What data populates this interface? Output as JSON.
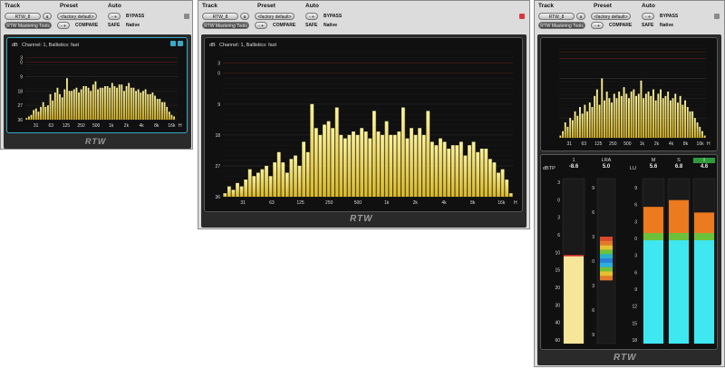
{
  "header": {
    "track_label": "Track",
    "preset_label": "Preset",
    "auto_label": "Auto",
    "track_name": "RTW_8",
    "track_suffix": "a",
    "preset_value": "<factory default>",
    "minus_plus": "- +",
    "bypass": "BYPASS",
    "compare": "COMPARE",
    "safe": "SAFE",
    "native": "Native",
    "plugin_name": "RTW Mastering Tools"
  },
  "chart_title": "Channel: 1, Ballistics: fast",
  "y_unit": "dB",
  "x_unit": "H",
  "logo": "RTW",
  "colors": {
    "bar": "#f2e27a",
    "window": "#dcdcdc",
    "bg": "#101010",
    "accent": "#35a9c7"
  },
  "chart_data": [
    {
      "type": "bar",
      "title": "Channel: 1, Ballistics: fast",
      "ylabel": "dB",
      "yticks": [
        "3",
        "0",
        "9",
        "18",
        "27",
        "36"
      ],
      "xticks": [
        "31",
        "63",
        "125",
        "250",
        "500",
        "1k",
        "2k",
        "4k",
        "8k",
        "16k"
      ],
      "ylim": [
        -36,
        6
      ],
      "values": [
        -35,
        -34,
        -33,
        -30,
        -29,
        -31,
        -28,
        -25,
        -28,
        -27,
        -20,
        -24,
        -19,
        -16,
        -20,
        -22,
        -17,
        -10,
        -18,
        -18,
        -17,
        -16,
        -19,
        -17,
        -15,
        -15,
        -16,
        -18,
        -14,
        -12,
        -17,
        -16,
        -16,
        -15,
        -15,
        -16,
        -13,
        -15,
        -16,
        -14,
        -14,
        -18,
        -15,
        -13,
        -16,
        -16,
        -18,
        -17,
        -19,
        -18,
        -17,
        -20,
        -20,
        -19,
        -21,
        -23,
        -23,
        -25,
        -25,
        -28,
        -31,
        -33,
        -34,
        -36
      ]
    },
    {
      "type": "bar",
      "title": "Channel: 1, Ballistics: fast",
      "ylabel": "dB",
      "yticks": [
        "3",
        "0",
        "9",
        "18",
        "27",
        "36"
      ],
      "xticks": [
        "31",
        "63",
        "125",
        "250",
        "500",
        "1k",
        "2k",
        "4k",
        "8k",
        "16k"
      ],
      "ylim": [
        -36,
        6
      ],
      "values": [
        -35,
        -33,
        -34,
        -32,
        -33,
        -31,
        -28,
        -30,
        -29,
        -28,
        -27,
        -30,
        -26,
        -23,
        -26,
        -29,
        -25,
        -24,
        -27,
        -20,
        -23,
        -9,
        -16,
        -18,
        -15,
        -14,
        -16,
        -10,
        -18,
        -19,
        -18,
        -17,
        -18,
        -16,
        -17,
        -19,
        -11,
        -17,
        -18,
        -14,
        -18,
        -18,
        -17,
        -10,
        -19,
        -16,
        -18,
        -16,
        -18,
        -11,
        -20,
        -21,
        -19,
        -20,
        -22,
        -21,
        -21,
        -20,
        -24,
        -21,
        -20,
        -23,
        -22,
        -22,
        -25,
        -26,
        -29,
        -28,
        -31,
        -35
      ]
    },
    {
      "type": "bar",
      "title": "",
      "xticks": [
        "31",
        "63",
        "125",
        "250",
        "500",
        "1k",
        "2k",
        "4k",
        "8k",
        "16k"
      ],
      "ylim": [
        -36,
        6
      ],
      "values": [
        -35,
        -33,
        -29,
        -31,
        -27,
        -28,
        -24,
        -26,
        -22,
        -25,
        -21,
        -24,
        -20,
        -22,
        -17,
        -14,
        -21,
        -9,
        -19,
        -15,
        -18,
        -20,
        -16,
        -18,
        -15,
        -17,
        -13,
        -16,
        -18,
        -15,
        -14,
        -17,
        -16,
        -10,
        -18,
        -16,
        -15,
        -17,
        -14,
        -19,
        -16,
        -14,
        -18,
        -17,
        -15,
        -19,
        -18,
        -16,
        -20,
        -17,
        -21,
        -19,
        -22,
        -24,
        -24,
        -27,
        -29,
        -31,
        -33,
        -35
      ]
    }
  ],
  "meters": {
    "peak": {
      "label": "1",
      "value": "-8.6",
      "unit": "dBTP",
      "level": -8.6,
      "scale": [
        "3",
        "0",
        "3",
        "6",
        "10",
        "15",
        "20",
        "30",
        "40",
        "60"
      ]
    },
    "lra": {
      "label": "LRA",
      "value": "5.0",
      "scale": [
        "9",
        "6",
        "3",
        "0",
        "3",
        "6",
        "9"
      ]
    },
    "loud_unit": "LU",
    "loudness": [
      {
        "label": "M",
        "value": "5.6",
        "level": 5.6
      },
      {
        "label": "S",
        "value": "6.8",
        "level": 6.8
      },
      {
        "label": "I",
        "value": "4.6",
        "level": 4.6
      }
    ],
    "lu_scale": [
      "9",
      "6",
      "3",
      "0",
      "3",
      "6",
      "9",
      "12",
      "15",
      "18"
    ]
  }
}
